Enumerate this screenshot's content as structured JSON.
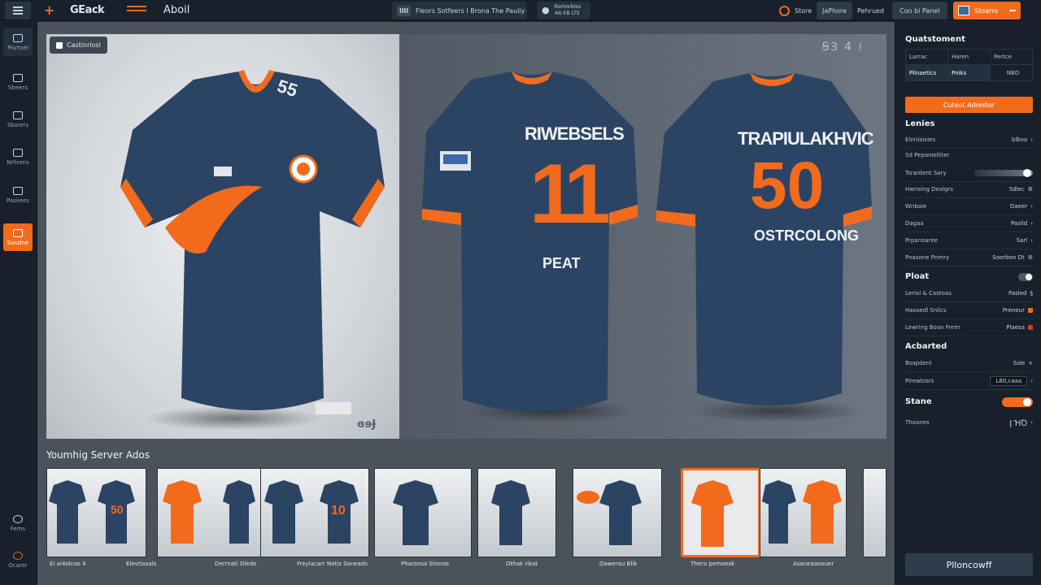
{
  "topbar": {
    "brand": "GEack",
    "about": "Aboil",
    "pill1_mini": "llll",
    "pill1_text": "Fleors Sotfeers I Brona The Pauliy",
    "pill2_text": "Rorlmrktos\n4ib EB LTS",
    "store": "Store",
    "btn_jphore": "JaPhore",
    "preferred": "Pehrued",
    "con_panel": "Con bi Panel",
    "save": "Stoarro"
  },
  "sidebar": {
    "items": [
      {
        "label": "Pisrtoel",
        "icon": "grid-icon"
      },
      {
        "label": "Sbeers",
        "icon": "layers-icon"
      },
      {
        "label": "Sbaiers",
        "icon": "shapes-icon"
      },
      {
        "label": "Nrhrens",
        "icon": "image-icon"
      },
      {
        "label": "Pasiiees",
        "icon": "palette-icon"
      },
      {
        "label": "Sasslne",
        "icon": "pen-icon"
      },
      {
        "label": "Fems",
        "icon": "help-icon"
      },
      {
        "label": "Ocarer",
        "icon": "user-icon"
      }
    ]
  },
  "canvas": {
    "view_label": "Castinrlosl",
    "corner_marks": "ꞨꞫ 4 ⁞",
    "front_mark": "ɞɘɈ",
    "back1_name": "RIWEBSELS",
    "back1_number": "11",
    "back1_sub": "PEAT",
    "back2_name": "TRAPIULAKHVIC",
    "back2_number": "50",
    "back2_sub": "OSTRCOLONG"
  },
  "recent": {
    "title": "Youmhig Server Ados",
    "labels": [
      "Ei ai4olnas  4",
      "Elevtisaals",
      "Derrnati Olede",
      "Freyiacarr Notis Soneads",
      "Pharonsa Stonoe",
      "Othak rikat",
      "Oawerau Blik",
      "Thera pemoesk",
      "Asaneaaoouer"
    ]
  },
  "props": {
    "section1": "Quatstoment",
    "table": [
      [
        "Larrac",
        "Haren",
        "Pertce"
      ],
      [
        "Pilnaetics",
        "Pniks",
        "NBD"
      ]
    ],
    "orange_button": "Cuteot Adrestor",
    "section2": "Lenies",
    "rows_a": [
      {
        "label": "Elnnlaisies",
        "value": "blbvo"
      },
      {
        "label": "Sd Pepanielliter",
        "value": ""
      },
      {
        "label": "Tsrardent Sary",
        "value": ""
      },
      {
        "label": "Hwnsing Dealgrs",
        "value": "Sdlec"
      },
      {
        "label": "Wnbaie",
        "value": "Daeer"
      },
      {
        "label": "Dagaa",
        "value": "Paslid"
      },
      {
        "label": "Prpanoaree",
        "value": "Sarl"
      },
      {
        "label": "Pnasone Pnmry",
        "value": "Soorbon Dt"
      }
    ],
    "section3": "Ploat",
    "rows_b": [
      {
        "label": "Lerial & Castoas",
        "value": "Pasled"
      },
      {
        "label": "Hasoedl Snlics",
        "value": "Preneur"
      },
      {
        "label": "Lewring Boan Frem",
        "value": "Plaesa"
      }
    ],
    "section4": "Acbarted",
    "rows_c": [
      {
        "label": "Bsapdenl",
        "value": "Ssle"
      },
      {
        "label": "Pirewbisrs",
        "value": "L60,caaa"
      }
    ],
    "section5": "Stane",
    "rows_d": [
      {
        "label": "Thoanes",
        "value": "ǀ ꞪꝹ"
      }
    ],
    "bottom_button": "Plloncowff"
  },
  "colors": {
    "accent": "#f26b1d",
    "navy": "#2c4463",
    "panel": "#17202b"
  }
}
